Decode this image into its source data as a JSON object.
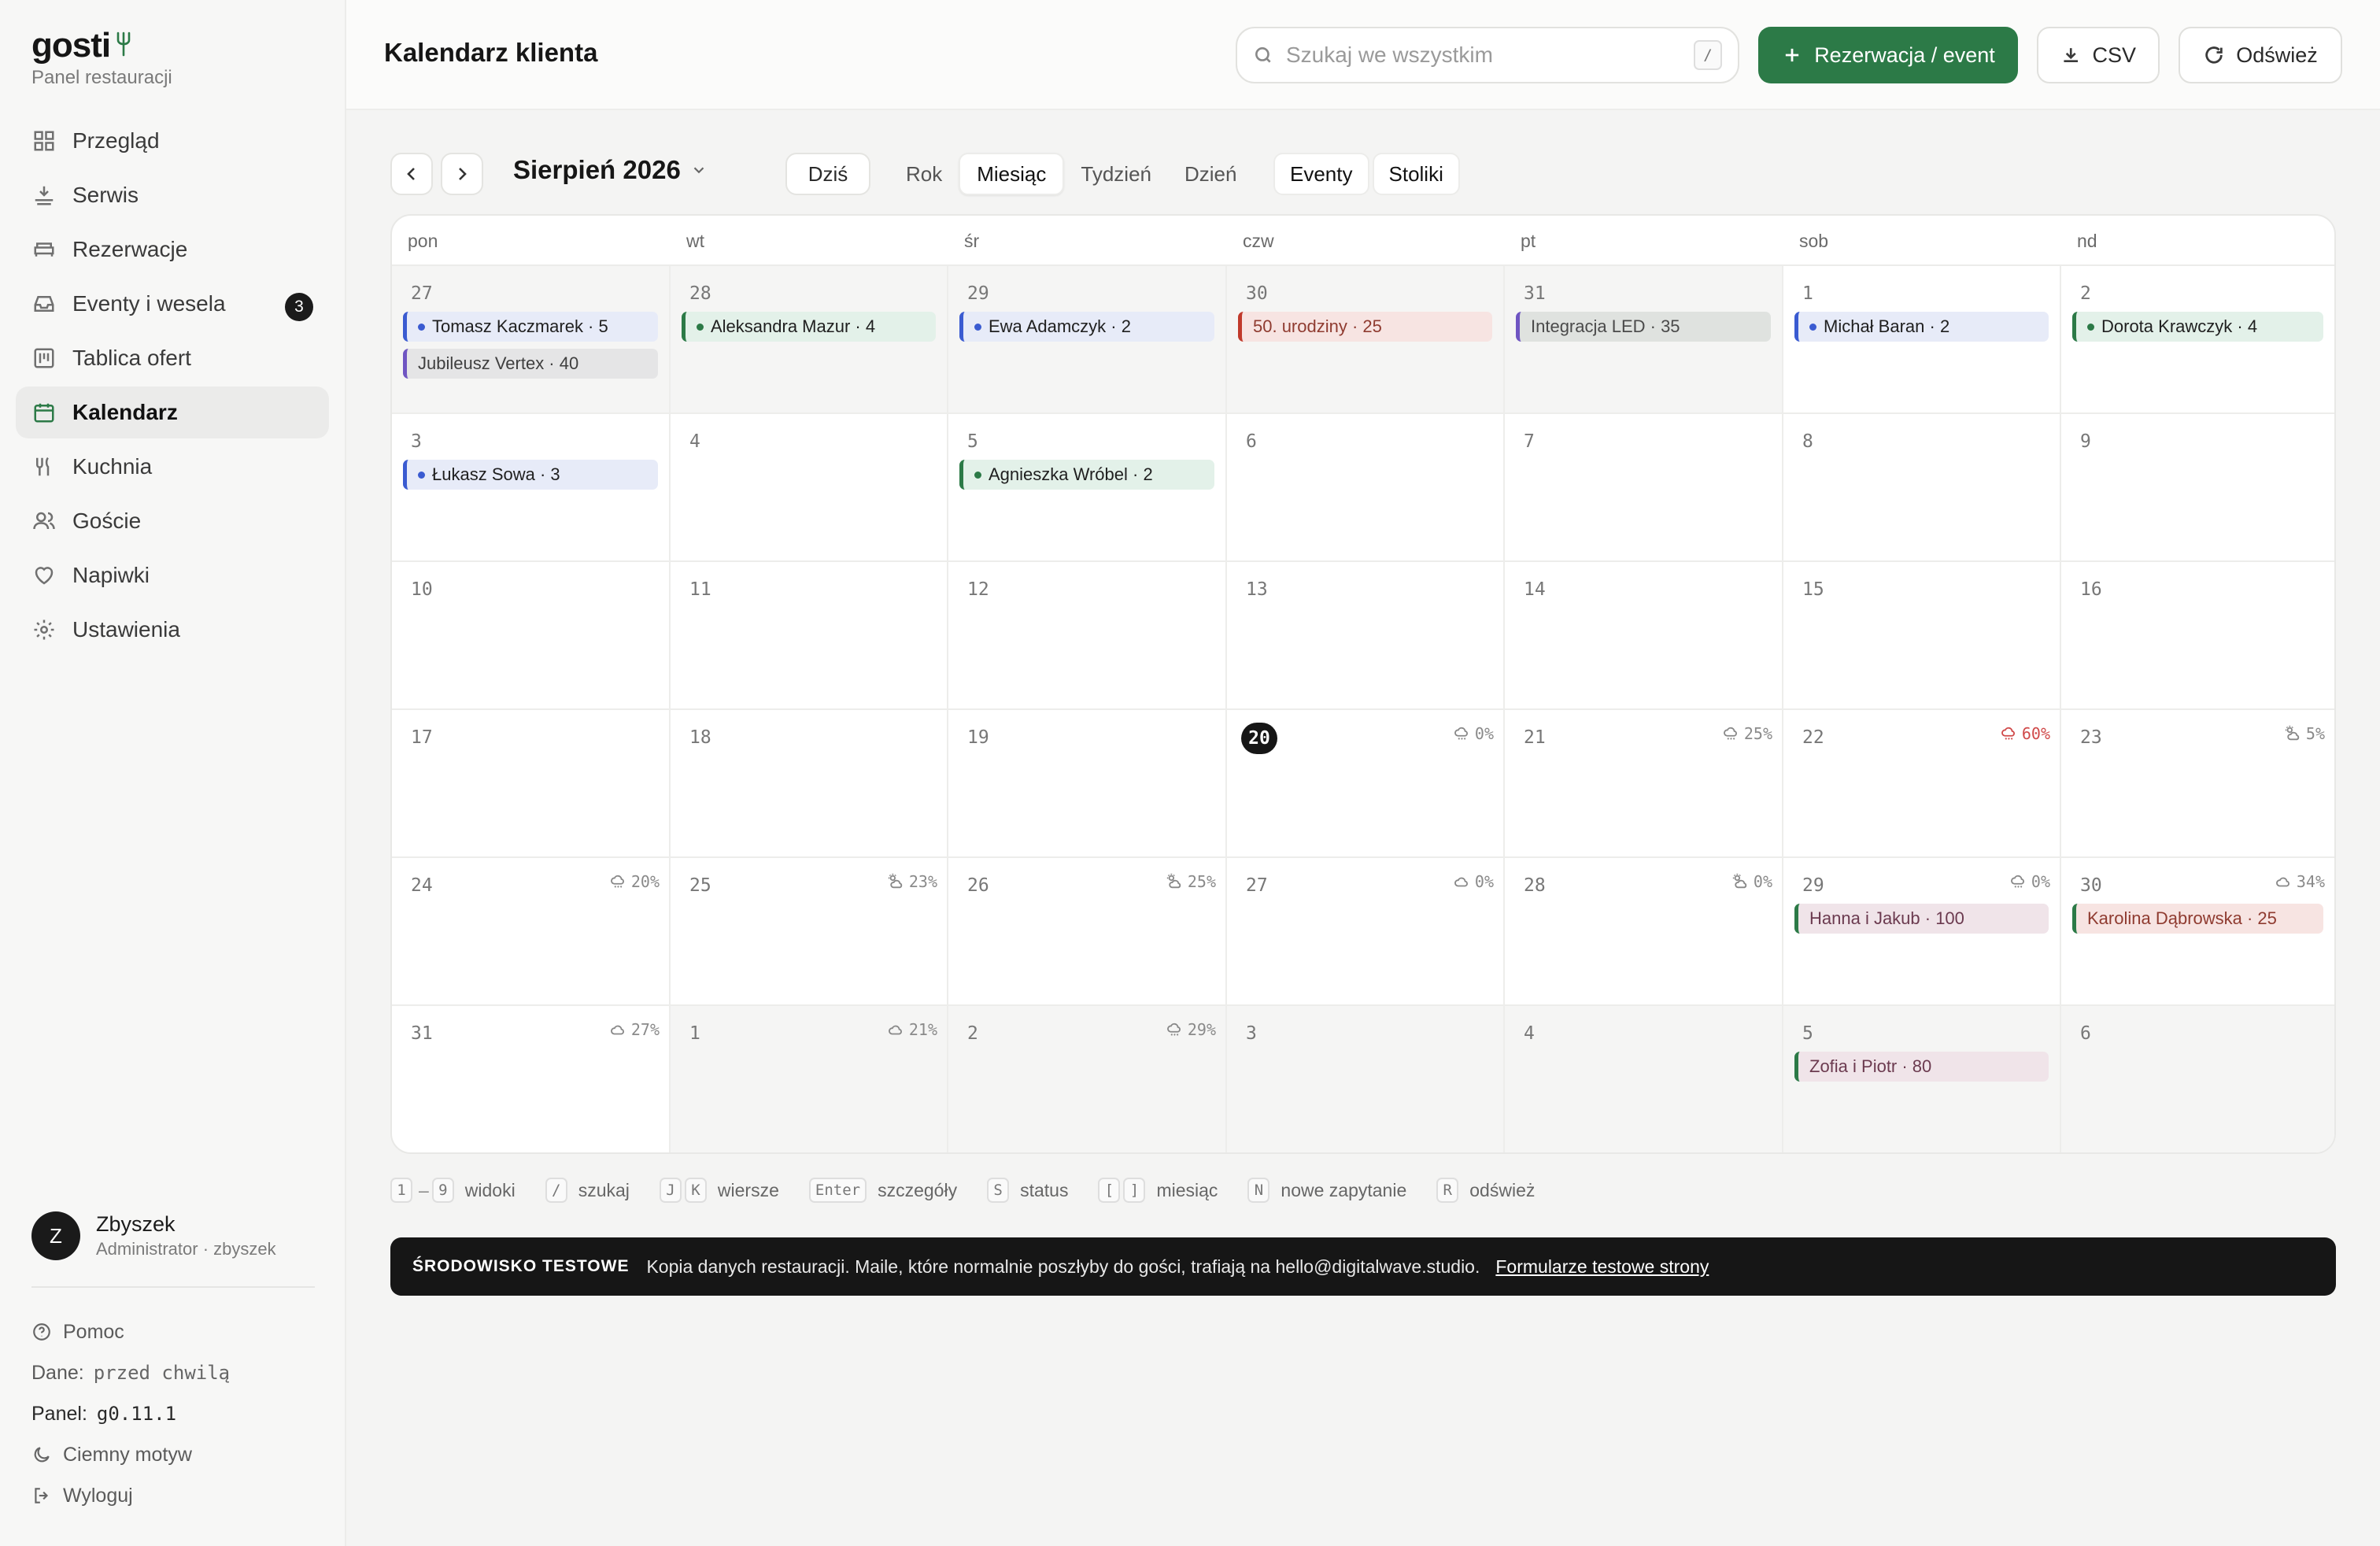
{
  "brand": {
    "name": "gosti",
    "subtitle": "Panel restauracji"
  },
  "nav": [
    {
      "label": "Przegląd",
      "icon": "grid-icon"
    },
    {
      "label": "Serwis",
      "icon": "serve-icon"
    },
    {
      "label": "Rezerwacje",
      "icon": "bed-icon"
    },
    {
      "label": "Eventy i wesela",
      "icon": "inbox-icon",
      "badge": "3"
    },
    {
      "label": "Tablica ofert",
      "icon": "board-icon"
    },
    {
      "label": "Kalendarz",
      "icon": "calendar-icon",
      "active": true
    },
    {
      "label": "Kuchnia",
      "icon": "utensils-icon"
    },
    {
      "label": "Goście",
      "icon": "users-icon"
    },
    {
      "label": "Napiwki",
      "icon": "heart-icon"
    },
    {
      "label": "Ustawienia",
      "icon": "gear-icon"
    }
  ],
  "user": {
    "initial": "Z",
    "name": "Zbyszek",
    "role": "Administrator · zbyszek"
  },
  "footer": {
    "help": "Pomoc",
    "data_label": "Dane:",
    "data_value": "przed chwilą",
    "panel_label": "Panel:",
    "panel_value": "g0.11.1",
    "dark_mode": "Ciemny motyw",
    "logout": "Wyloguj"
  },
  "header": {
    "title": "Kalendarz klienta",
    "search_placeholder": "Szukaj we wszystkim",
    "search_shortcut": "/",
    "new_button": "Rezerwacja / event",
    "csv_button": "CSV",
    "refresh_button": "Odśwież"
  },
  "toolbar": {
    "month": "Sierpień 2026",
    "today": "Dziś",
    "views": [
      "Rok",
      "Miesiąc",
      "Tydzień",
      "Dzień"
    ],
    "active_view": "Miesiąc",
    "layers": [
      "Eventy",
      "Stoliki"
    ]
  },
  "calendar": {
    "weekdays": [
      "pon",
      "wt",
      "śr",
      "czw",
      "pt",
      "sob",
      "nd"
    ],
    "weeks": [
      [
        {
          "day": "27",
          "other": true,
          "events": [
            {
              "text": "Tomasz Kaczmarek · 5",
              "kind": "blue"
            },
            {
              "text": "Jubileusz Vertex · 40",
              "kind": "purple"
            }
          ]
        },
        {
          "day": "28",
          "other": true,
          "events": [
            {
              "text": "Aleksandra Mazur · 4",
              "kind": "green"
            }
          ]
        },
        {
          "day": "29",
          "other": true,
          "events": [
            {
              "text": "Ewa Adamczyk · 2",
              "kind": "blue"
            }
          ]
        },
        {
          "day": "30",
          "other": true,
          "events": [
            {
              "text": "50. urodziny · 25",
              "kind": "red"
            }
          ]
        },
        {
          "day": "31",
          "other": true,
          "events": [
            {
              "text": "Integracja LED · 35",
              "kind": "olive"
            }
          ]
        },
        {
          "day": "1",
          "events": [
            {
              "text": "Michał Baran · 2",
              "kind": "blue"
            }
          ]
        },
        {
          "day": "2",
          "events": [
            {
              "text": "Dorota Krawczyk · 4",
              "kind": "green"
            }
          ]
        }
      ],
      [
        {
          "day": "3",
          "events": [
            {
              "text": "Łukasz Sowa · 3",
              "kind": "blue"
            }
          ]
        },
        {
          "day": "4",
          "events": []
        },
        {
          "day": "5",
          "events": [
            {
              "text": "Agnieszka Wróbel · 2",
              "kind": "green"
            }
          ]
        },
        {
          "day": "6",
          "events": []
        },
        {
          "day": "7",
          "events": []
        },
        {
          "day": "8",
          "events": []
        },
        {
          "day": "9",
          "events": []
        }
      ],
      [
        {
          "day": "10",
          "events": []
        },
        {
          "day": "11",
          "events": []
        },
        {
          "day": "12",
          "events": []
        },
        {
          "day": "13",
          "events": []
        },
        {
          "day": "14",
          "events": []
        },
        {
          "day": "15",
          "events": []
        },
        {
          "day": "16",
          "events": []
        }
      ],
      [
        {
          "day": "17",
          "events": []
        },
        {
          "day": "18",
          "events": []
        },
        {
          "day": "19",
          "events": []
        },
        {
          "day": "20",
          "today": true,
          "weather": {
            "text": "0%",
            "icon": "cloud-rain-icon"
          },
          "events": []
        },
        {
          "day": "21",
          "weather": {
            "text": "25%",
            "icon": "cloud-rain-icon"
          },
          "events": []
        },
        {
          "day": "22",
          "weather": {
            "text": "60%",
            "icon": "cloud-rain-icon",
            "warn": true
          },
          "events": []
        },
        {
          "day": "23",
          "weather": {
            "text": "5%",
            "icon": "sun-cloud-icon"
          },
          "events": []
        }
      ],
      [
        {
          "day": "24",
          "weather": {
            "text": "20%",
            "icon": "cloud-rain-icon"
          },
          "events": []
        },
        {
          "day": "25",
          "weather": {
            "text": "23%",
            "icon": "sun-cloud-icon"
          },
          "events": []
        },
        {
          "day": "26",
          "weather": {
            "text": "25%",
            "icon": "sun-cloud-icon"
          },
          "events": []
        },
        {
          "day": "27",
          "weather": {
            "text": "0%",
            "icon": "cloud-icon"
          },
          "events": []
        },
        {
          "day": "28",
          "weather": {
            "text": "0%",
            "icon": "sun-cloud-icon"
          },
          "events": []
        },
        {
          "day": "29",
          "weather": {
            "text": "0%",
            "icon": "cloud-rain-icon"
          },
          "events": [
            {
              "text": "Hanna i Jakub · 100",
              "kind": "wedding"
            }
          ]
        },
        {
          "day": "30",
          "weather": {
            "text": "34%",
            "icon": "cloud-icon"
          },
          "events": [
            {
              "text": "Karolina Dąbrowska · 25",
              "kind": "wedding-red"
            }
          ]
        }
      ],
      [
        {
          "day": "31",
          "weather": {
            "text": "27%",
            "icon": "cloud-icon"
          },
          "events": []
        },
        {
          "day": "1",
          "other": true,
          "weather": {
            "text": "21%",
            "icon": "cloud-icon"
          },
          "events": []
        },
        {
          "day": "2",
          "other": true,
          "weather": {
            "text": "29%",
            "icon": "cloud-rain-icon"
          },
          "events": []
        },
        {
          "day": "3",
          "other": true,
          "events": []
        },
        {
          "day": "4",
          "other": true,
          "events": []
        },
        {
          "day": "5",
          "other": true,
          "events": [
            {
              "text": "Zofia i Piotr · 80",
              "kind": "wedding"
            }
          ]
        },
        {
          "day": "6",
          "other": true,
          "events": []
        }
      ]
    ]
  },
  "shortcuts": [
    {
      "keys": [
        "1",
        "9"
      ],
      "range": true,
      "label": "widoki"
    },
    {
      "keys": [
        "/"
      ],
      "label": "szukaj"
    },
    {
      "keys": [
        "J",
        "K"
      ],
      "label": "wiersze"
    },
    {
      "keys": [
        "Enter"
      ],
      "label": "szczegóły"
    },
    {
      "keys": [
        "S"
      ],
      "label": "status"
    },
    {
      "keys": [
        "[",
        "]"
      ],
      "label": "miesiąc"
    },
    {
      "keys": [
        "N"
      ],
      "label": "nowe zapytanie"
    },
    {
      "keys": [
        "R"
      ],
      "label": "odśwież"
    }
  ],
  "banner": {
    "tag": "ŚRODOWISKO TESTOWE",
    "text": "Kopia danych restauracji. Maile, które normalnie poszłyby do gości, trafiają na hello@digitalwave.studio.",
    "link": "Formularze testowe strony"
  },
  "colors": {
    "accent": "#2c7a47",
    "dark": "#161616",
    "event_blue": "#3a5bd1",
    "event_purple": "#6f55c2",
    "event_red": "#c0392b",
    "warn": "#d04a4a"
  }
}
